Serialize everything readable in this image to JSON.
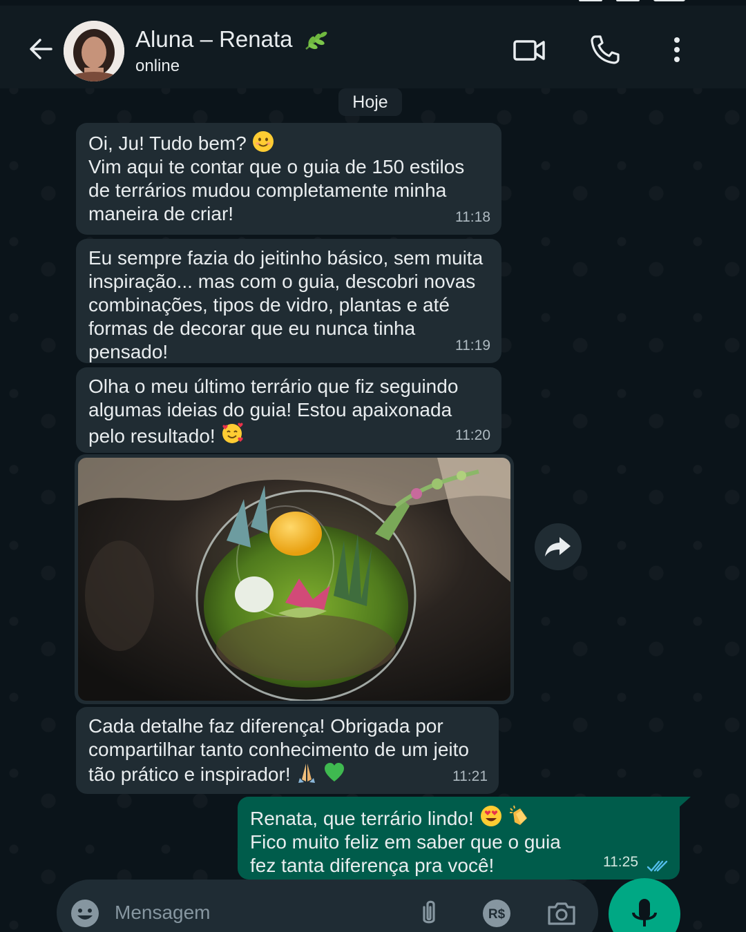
{
  "header": {
    "contact_name": "Aluna – Renata",
    "contact_status": "online",
    "avatar_icon": "contact-avatar",
    "back_icon": "arrow-left-icon",
    "video_icon": "video-camera-icon",
    "call_icon": "phone-icon",
    "menu_icon": "more-vertical-icon"
  },
  "chat": {
    "date_label": "Hoje",
    "messages": [
      {
        "direction": "in",
        "line1": "Oi, Ju! Tudo bem?",
        "line2": "Vim aqui te contar que o guia de 150 estilos",
        "line3": "de terrários mudou completamente minha",
        "line4": "maneira de criar!",
        "time": "11:18"
      },
      {
        "direction": "in",
        "line1": "Eu sempre fazia do jeitinho básico, sem muita",
        "line2": "inspiração... mas com o guia, descobri novas",
        "line3": "combinações, tipos de vidro, plantas e até",
        "line4": "formas de decorar que eu nunca tinha pensado!",
        "time": "11:19"
      },
      {
        "direction": "in",
        "line1": "Olha o meu último terrário que fiz seguindo",
        "line2": "algumas ideias do guia! Estou apaixonada",
        "line3": "pelo resultado!",
        "time": "11:20"
      },
      {
        "direction": "in",
        "type": "image",
        "image_subject": "glass-terrarium-photo"
      },
      {
        "direction": "in",
        "line1": "Cada detalhe faz diferença! Obrigada por",
        "line2": "compartilhar tanto conhecimento de um jeito",
        "line3": "tão prático e inspirador!",
        "time": "11:21"
      },
      {
        "direction": "out",
        "line1": "Renata, que terrário lindo!",
        "line2": "Fico muito feliz em saber que o guia",
        "line3": "fez tanta diferença pra você!",
        "time": "11:25",
        "status": "read"
      }
    ]
  },
  "composer": {
    "placeholder": "Mensagem",
    "emoji_icon": "emoji-icon",
    "attach_icon": "paperclip-icon",
    "payment_icon": "payment-rs-icon",
    "camera_icon": "camera-icon",
    "mic_icon": "microphone-icon"
  },
  "colors": {
    "background": "#0b141a",
    "header": "#111b21",
    "incoming_bubble": "#202c33",
    "outgoing_bubble": "#005c4b",
    "accent": "#00a884",
    "read_ticks": "#53bdeb"
  }
}
